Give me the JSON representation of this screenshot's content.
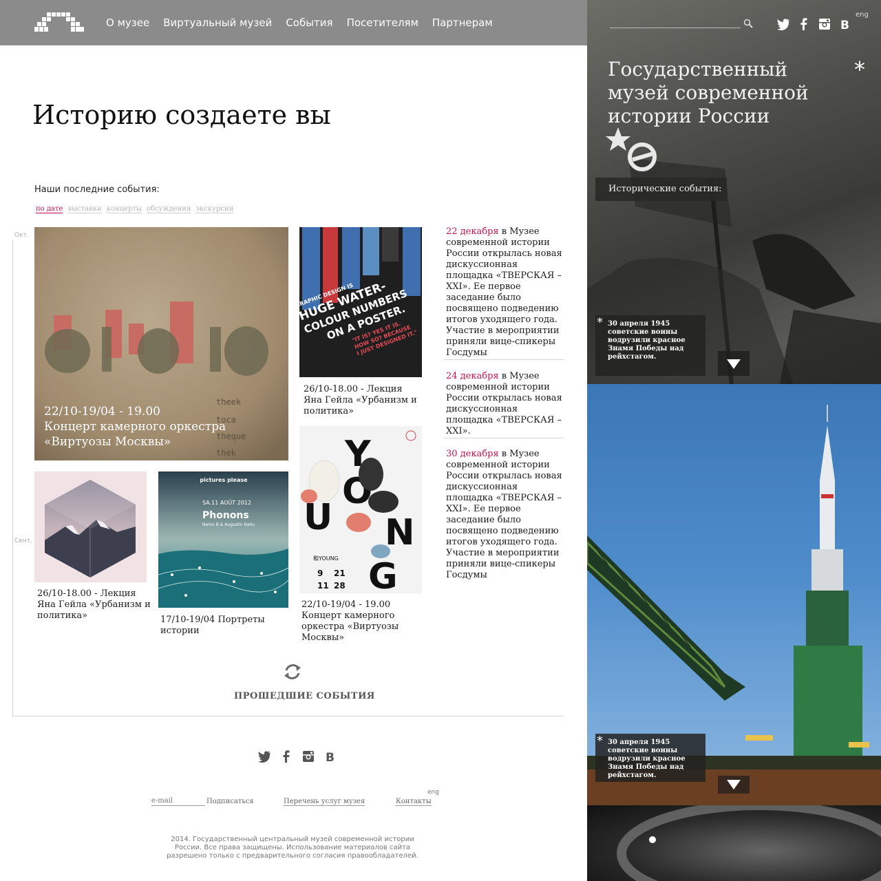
{
  "nav": {
    "items": [
      "О музее",
      "Виртуальный музей",
      "События",
      "Посетителям",
      "Партнерам"
    ]
  },
  "main": {
    "title": "Историю создаете вы",
    "events_heading": "Наши последние события:",
    "filters": [
      "по дате",
      "выставки",
      "концерты",
      "обсуждения",
      "экскурсии"
    ],
    "months": [
      "Окт.",
      "Сент."
    ],
    "featured": {
      "image_text": [
        "theek",
        "toca",
        "theque",
        "thek"
      ],
      "caption_date": "22/10-19/04 - 19.00",
      "caption_text": "Концерт камерного оркестра «Виртуозы Москвы»"
    },
    "poster_water": {
      "lines": [
        "GRAPHIC DESIGN IS",
        "HUGE WATER-",
        "COLOUR NUMBERS",
        "ON A POSTER.",
        "\"IT IS? YES IT IS.",
        "HOW SO? BECAUSE",
        "I JUST DESIGNED IT.\""
      ],
      "caption": "26/10-18.00 - Лекция Яна Гейла «Урбанизм и политика»"
    },
    "poster_hex": {
      "caption": "26/10-18.00 - Лекция Яна Гейла «Урбанизм и политика»"
    },
    "poster_phonons": {
      "brand": "pictures please",
      "date_line": "SA.11 AOÛT 2012",
      "title": "Phonons",
      "subtitle": "Nemo B & Augustin Bahu",
      "caption": "17/10-19/04 Портреты истории"
    },
    "poster_young": {
      "letters": [
        "Y",
        "O",
        "U",
        "N",
        "G"
      ],
      "label": "和YOUNG",
      "dates": [
        "9",
        "21",
        "11",
        "28"
      ],
      "caption": "22/10-19/04 - 19.00 Концерт камерного оркестра «Виртуозы Москвы»"
    },
    "news": [
      {
        "date": "22 декабря",
        "text": " в Музее современной истории России открылась новая дискуссионная площадка «ТВЕРСКАЯ – XXI». Ее первое заседание было посвящено подведению итогов уходящего года. Участие в мероприятии приняли вице-спикеры Госдумы"
      },
      {
        "date": "24 декабря",
        "text": " в Музее современной истории России открылась новая дискуссионная площадка «ТВЕРСКАЯ – XXI»."
      },
      {
        "date": "30 декабря",
        "text": " в Музее современной истории России открылась новая дискуссионная площадка «ТВЕРСКАЯ – XXI». Ее первое заседание было посвящено подведению итогов уходящего года. Участие в мероприятии приняли вице-спикеры Госдумы"
      }
    ],
    "past_events": "ПРОШЕДШИЕ СОБЫТИЯ"
  },
  "footer": {
    "email_placeholder": "e-mail",
    "subscribe": "Подписаться",
    "services": "Перечень услуг музея",
    "contacts": "Контакты",
    "eng": "eng",
    "copyright": "2014. Государственный центральный музей современной истории России. Все права защищены. Использование материалов сайта разрешено только с предварительного согласия правообладателей."
  },
  "side": {
    "eng": "eng",
    "museum_name": "Государственный музей современной истории России",
    "historical_events": "Исторические события:",
    "fact_1": "30 апреля 1945 советские воины водрузили красное Знамя Победы над рейхстагом.",
    "fact_2": "30 апреля 1945 советские воины водрузили красное Знамя Победы над рейхстагом."
  },
  "colors": {
    "accent": "#c8104a",
    "topbar": "#8b8b8b"
  },
  "icons": [
    "twitter-icon",
    "facebook-icon",
    "instagram-icon",
    "vk-icon",
    "search-icon",
    "refresh-icon",
    "arrow-down-icon",
    "asterisk-icon"
  ]
}
